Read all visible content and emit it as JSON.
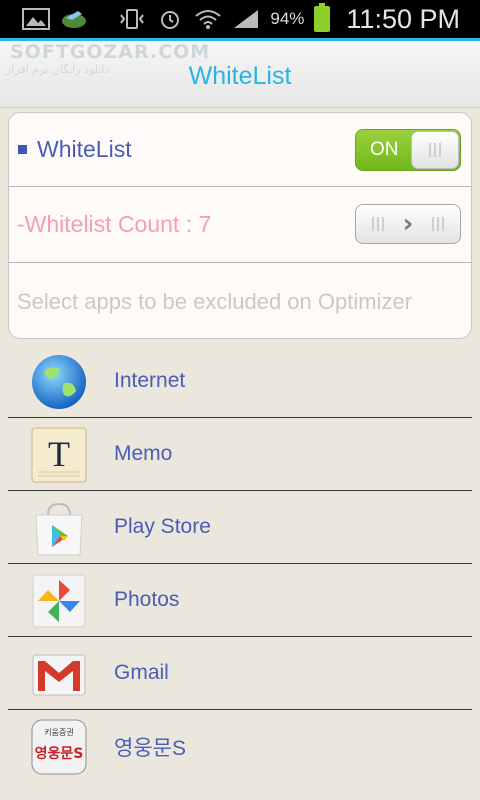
{
  "status_bar": {
    "battery_percent": "94%",
    "time": "11:50 PM",
    "icons": [
      "gallery-icon",
      "app-notification-icon",
      "vibrate-icon",
      "alarm-icon",
      "wifi-icon",
      "signal-icon",
      "battery-icon"
    ]
  },
  "watermark": {
    "brand": "SOFTGOZAR.COM",
    "tagline": "دانلود رایگان نرم افزار"
  },
  "header": {
    "title": "WhiteList",
    "accent": "#29b6e8"
  },
  "settings": {
    "whitelist_label": "WhiteList",
    "toggle_state": "ON",
    "count_label": "-Whitelist Count : 7",
    "description": "Select apps to be excluded on Optimizer"
  },
  "apps": [
    {
      "label": "Internet",
      "icon": "internet-globe-icon"
    },
    {
      "label": "Memo",
      "icon": "memo-icon"
    },
    {
      "label": "Play Store",
      "icon": "play-store-icon"
    },
    {
      "label": "Photos",
      "icon": "photos-pinwheel-icon"
    },
    {
      "label": "Gmail",
      "icon": "gmail-icon"
    },
    {
      "label": "영웅문S",
      "icon": "youngwoongmun-icon"
    }
  ],
  "icon_badge_text": {
    "memo": "T",
    "youngwoongmun_top": "키움증권",
    "youngwoongmun_main": "영웅문S"
  }
}
